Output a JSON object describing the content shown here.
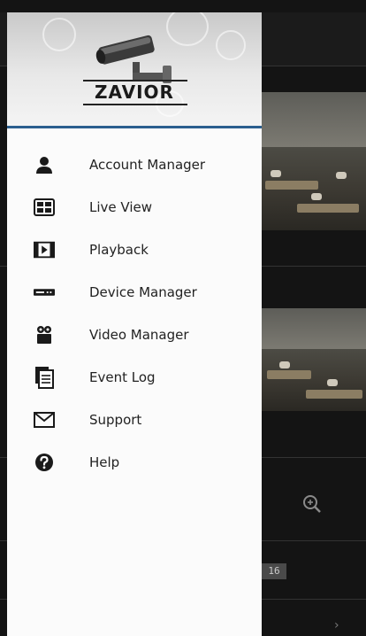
{
  "brand": {
    "logo_text": "ZAVIOR"
  },
  "menu": {
    "items": [
      {
        "label": "Account Manager",
        "icon": "account-icon"
      },
      {
        "label": "Live View",
        "icon": "live-view-icon"
      },
      {
        "label": "Playback",
        "icon": "playback-icon"
      },
      {
        "label": "Device Manager",
        "icon": "device-manager-icon"
      },
      {
        "label": "Video Manager",
        "icon": "video-manager-icon"
      },
      {
        "label": "Event Log",
        "icon": "event-log-icon"
      },
      {
        "label": "Support",
        "icon": "support-icon"
      },
      {
        "label": "Help",
        "icon": "help-icon"
      }
    ]
  },
  "background": {
    "channel_badge": "16"
  },
  "colors": {
    "header_border": "#2b5f8f",
    "icon": "#1a1a1a"
  }
}
